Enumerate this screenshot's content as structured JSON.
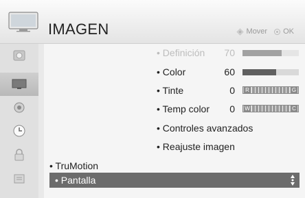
{
  "header": {
    "title": "IMAGEN",
    "hint_move": "Mover",
    "hint_ok": "OK"
  },
  "rail": {
    "items": [
      {
        "icon": "photo-icon"
      },
      {
        "icon": "picture-tv-icon",
        "active": true
      },
      {
        "icon": "audio-icon"
      },
      {
        "icon": "clock-icon"
      },
      {
        "icon": "lock-icon"
      },
      {
        "icon": "options-icon"
      }
    ]
  },
  "submenu": {
    "definicion": {
      "label": "• Definición",
      "value": "70",
      "level": 0.7
    },
    "color": {
      "label": "• Color",
      "value": "60",
      "level": 0.6
    },
    "tinte": {
      "label": "• Tinte",
      "value": "0",
      "left_end": "R",
      "right_end": "G"
    },
    "temp_color": {
      "label": "• Temp color",
      "value": "0",
      "left_end": "W",
      "right_end": "C"
    },
    "controles": {
      "label": "• Controles avanzados"
    },
    "reajuste": {
      "label": "• Reajuste imagen"
    }
  },
  "main_menu": {
    "trumotion": {
      "label": "• TruMotion"
    },
    "pantalla": {
      "label": "• Pantalla"
    }
  }
}
